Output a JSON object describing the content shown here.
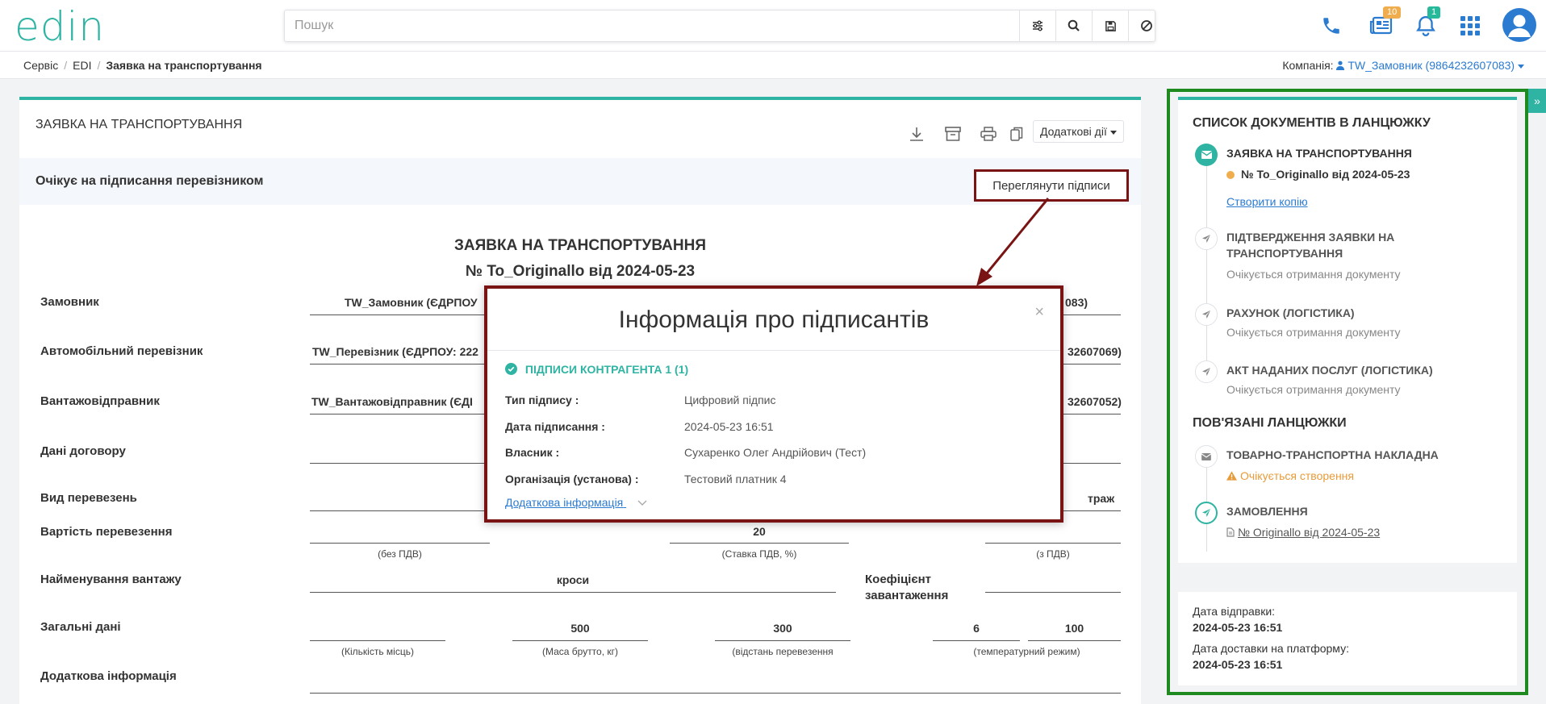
{
  "app": {
    "logo": "edin"
  },
  "search": {
    "placeholder": "Пошук"
  },
  "topbar": {
    "news_count": "10",
    "notif_count": "1"
  },
  "breadcrumb": {
    "items": [
      "Сервіс",
      "EDI"
    ],
    "current": "Заявка на транспортування"
  },
  "company": {
    "label": "Компанія:",
    "value": "TW_Замовник (9864232607083)"
  },
  "doc": {
    "header_title": "ЗАЯВКА НА ТРАНСПОРТУВАННЯ",
    "more_actions": "Додаткові дії",
    "status": "Очікує на підписання перевізником",
    "view_signatures": "Переглянути підписи",
    "title": "ЗАЯВКА НА ТРАНСПОРТУВАННЯ",
    "number": "№ To_Originallo від 2024-05-23",
    "fields": {
      "customer_label": "Замовник",
      "customer_value": "TW_Замовник (ЄДРПОУ",
      "customer_tail": "083)",
      "carrier_label": "Автомобільний перевізник",
      "carrier_value": "TW_Перевізник (ЄДРПОУ: 222",
      "carrier_tail": "32607069)",
      "shipper_label": "Вантажовідправник",
      "shipper_value": "TW_Вантажовідправник (ЄДІ",
      "shipper_tail": "32607052)",
      "contract_label": "Дані договору",
      "transport_type_label": "Вид перевезень",
      "transport_type_tail": "траж",
      "cost_label": "Вартість перевезення",
      "vat_rate": "20",
      "cap_no_vat": "(без ПДВ)",
      "cap_vat_rate": "(Ставка ПДВ, %)",
      "cap_with_vat": "(з ПДВ)",
      "cargo_label": "Найменування вантажу",
      "cargo_value": "кроси",
      "coef_label_1": "Коефіцієнт",
      "coef_label_2": "завантаження",
      "general_label": "Загальні дані",
      "gross_weight": "500",
      "distance": "300",
      "temp_min": "6",
      "temp_max": "100",
      "cap_places": "(Кількість місць)",
      "cap_gross": "(Маса брутто, кг)",
      "cap_distance": "(відстань перевезення",
      "cap_temp": "(температурний режим)",
      "extra_label": "Додаткова інформація"
    }
  },
  "modal": {
    "title": "Інформація про підписантів",
    "group": "ПІДПИСИ КОНТРАГЕНТА 1 (1)",
    "rows": [
      {
        "k": "Тип підпису :",
        "v": "Цифровий підпис"
      },
      {
        "k": "Дата підписання :",
        "v": "2024-05-23 16:51"
      },
      {
        "k": "Власник :",
        "v": "Сухаренко Олег Андрійович (Тест)"
      },
      {
        "k": "Організація (установа) :",
        "v": "Тестовий платник 4"
      }
    ],
    "more": "Додаткова інформація"
  },
  "chain": {
    "title": "СПИСОК ДОКУМЕНТІВ В ЛАНЦЮЖКУ",
    "items": [
      {
        "name": "ЗАЯВКА НА ТРАНСПОРТУВАННЯ",
        "number": "№ To_Originallo від 2024-05-23",
        "link": "Створити копію"
      },
      {
        "name_1": "ПІДТВЕРДЖЕННЯ ЗАЯВКИ НА",
        "name_2": "ТРАНСПОРТУВАННЯ",
        "sub": "Очікується отримання документу"
      },
      {
        "name": "РАХУНОК (ЛОГІСТИКА)",
        "sub": "Очікується отримання документу"
      },
      {
        "name": "АКТ НАДАНИХ ПОСЛУГ (ЛОГІСТИКА)",
        "sub": "Очікується отримання документу"
      }
    ],
    "related_title": "ПОВ'ЯЗАНІ ЛАНЦЮЖКИ",
    "related": [
      {
        "name": "ТОВАРНО-ТРАНСПОРТНА НАКЛАДНА",
        "sub": "Очікується створення"
      },
      {
        "name": "ЗАМОВЛЕННЯ",
        "link": "№ Originallo від 2024-05-23"
      }
    ]
  },
  "meta": {
    "sent_label": "Дата відправки:",
    "sent_value": "2024-05-23 16:51",
    "delivered_label": "Дата доставки на платформу:",
    "delivered_value": "2024-05-23 16:51"
  }
}
